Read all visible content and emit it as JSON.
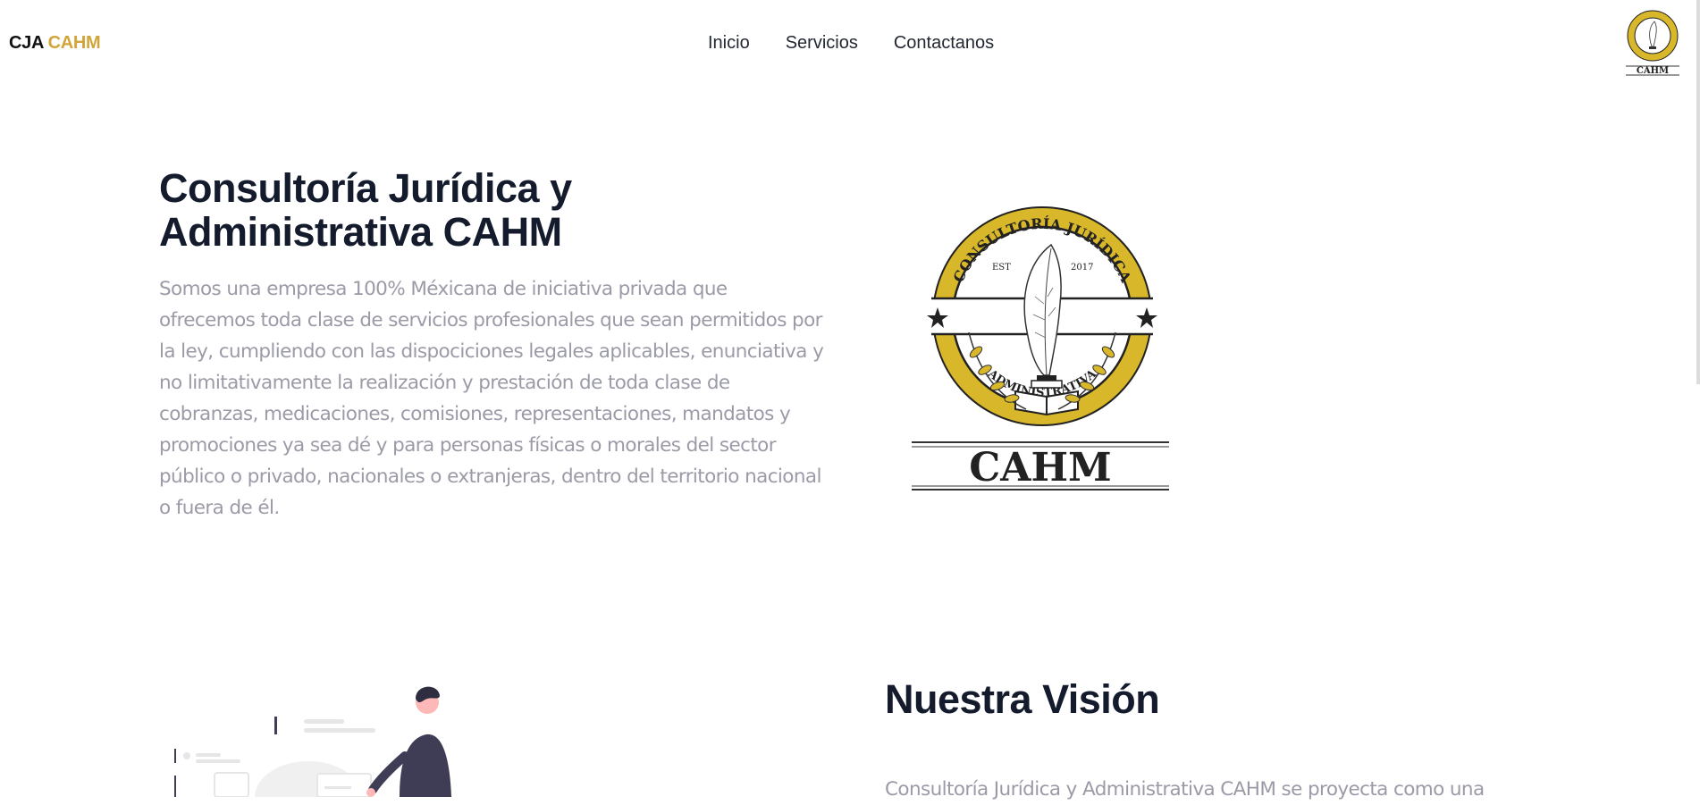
{
  "nav": {
    "brand_main": "CJA ",
    "brand_accent": "CAHM",
    "links": [
      "Inicio",
      "Servicios",
      "Contactanos"
    ],
    "logo_caption": "CAHM"
  },
  "hero": {
    "title": "Consultoría Jurídica y Administrativa CAHM",
    "text": "Somos una empresa 100% Méxicana de iniciativa privada que ofrecemos toda clase de servicios profesionales que sean permitidos por la ley, cumpliendo con las dispociciones legales aplicables, enunciativa y no limitativamente la realización y prestación de toda clase de cobranzas, medicaciones, comisiones, representaciones, mandatos y promociones ya sea dé y para personas físicas o morales del sector público o privado, nacionales o extranjeras, dentro del territorio nacional o fuera de él."
  },
  "logo": {
    "top_arc": "CONSULTORÍA JURÍDICA",
    "bottom_arc": "ADMINISTRATIVA",
    "est": "EST",
    "year": "2017",
    "wordmark": "CAHM"
  },
  "vision": {
    "title": "Nuestra Visión",
    "text": "Consultoría Jurídica y Administrativa CAHM se proyecta como una"
  },
  "colors": {
    "accent": "#d2a53a",
    "seal_gold": "#d8b72a",
    "heading": "#141b2d",
    "body_text": "#9b9ba8"
  }
}
